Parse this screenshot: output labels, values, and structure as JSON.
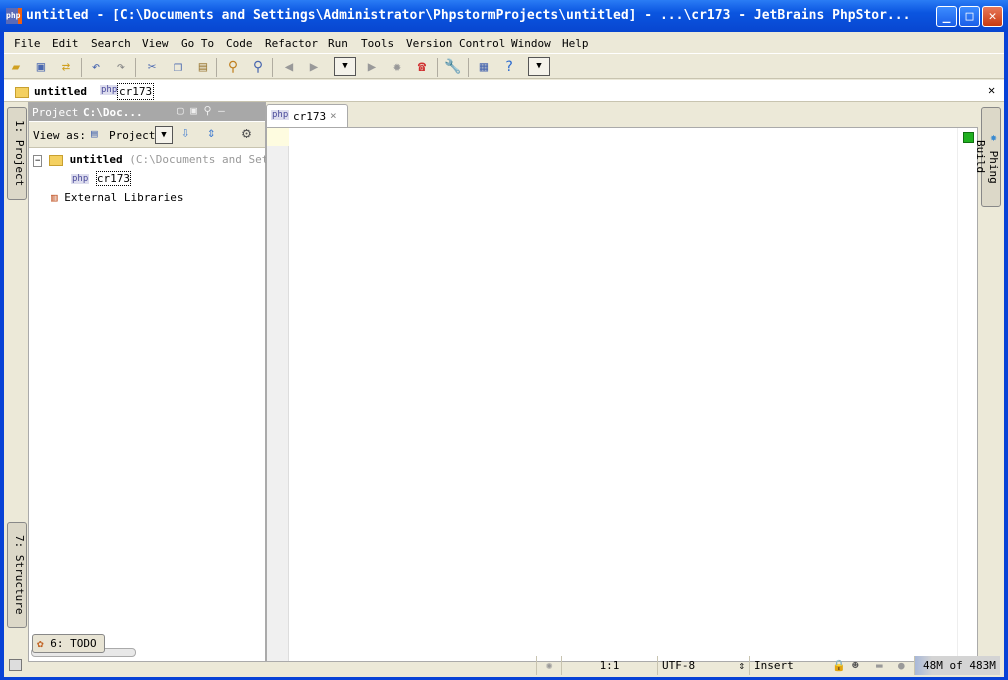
{
  "window": {
    "title": "untitled - [C:\\Documents and Settings\\Administrator\\PhpstormProjects\\untitled] - ...\\cr173 - JetBrains PhpStor...",
    "minimize": "_",
    "maximize": "□",
    "close": "✕"
  },
  "menu": [
    "File",
    "Edit",
    "Search",
    "View",
    "Go To",
    "Code",
    "Refactor",
    "Run",
    "Tools",
    "Version Control",
    "Window",
    "Help"
  ],
  "navbar": {
    "project": "untitled",
    "file": "cr173",
    "php_badge": "php",
    "close": "✕"
  },
  "left_tools": {
    "project": "1: Project",
    "structure": "7: Structure"
  },
  "project_panel": {
    "header": "Project",
    "path": "C:\\Doc...",
    "view_as": "View as:",
    "view_value": "Project",
    "tree": {
      "root": "untitled",
      "root_path": "(C:\\Documents and Sett",
      "file": "cr173",
      "libs": "External Libraries"
    }
  },
  "editor": {
    "tab": "cr173",
    "tab_close": "×"
  },
  "right_tools": {
    "phing": "Phing Build"
  },
  "bottom_tools": {
    "todo": "6: TODO"
  },
  "status": {
    "position": "1:1",
    "encoding": "UTF-8",
    "mode": "Insert",
    "memory": "48M of 483M"
  }
}
